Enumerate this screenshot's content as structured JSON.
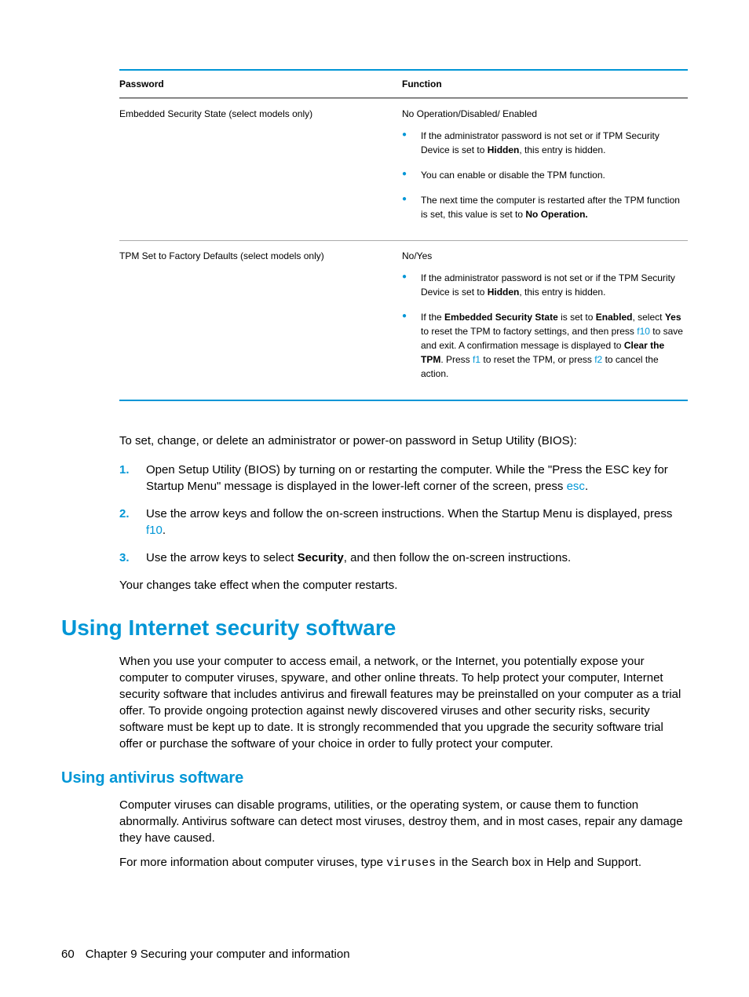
{
  "table": {
    "headers": {
      "left": "Password",
      "right": "Function"
    },
    "row1": {
      "name": "Embedded Security State (select models only)",
      "lead": "No Operation/Disabled/ Enabled",
      "b1a": "If the administrator password is not set or if TPM Security Device is set to ",
      "b1b": "Hidden",
      "b1c": ", this entry is hidden.",
      "b2": "You can enable or disable the TPM function.",
      "b3a": "The next time the computer is restarted after the TPM function is set, this value is set to ",
      "b3b": "No Operation."
    },
    "row2": {
      "name": "TPM Set to Factory Defaults (select models only)",
      "lead": "No/Yes",
      "b1a": "If the administrator password is not set or if the TPM Security Device is set to ",
      "b1b": "Hidden",
      "b1c": ", this entry is hidden.",
      "b2a": "If the ",
      "b2b": "Embedded Security State",
      "b2c": " is set to ",
      "b2d": "Enabled",
      "b2e": ", select ",
      "b2f": "Yes",
      "b2g": " to reset the TPM to factory settings, and then press ",
      "b2h": "f10",
      "b2i": " to save and exit. A confirmation message is displayed to ",
      "b2j": "Clear the TPM",
      "b2k": ". Press ",
      "b2l": "f1",
      "b2m": " to reset the TPM, or press ",
      "b2n": "f2",
      "b2o": " to cancel the action."
    }
  },
  "body": {
    "intro": "To set, change, or delete an administrator or power-on password in Setup Utility (BIOS):",
    "step1a": "Open Setup Utility (BIOS) by turning on or restarting the computer. While the \"Press the ESC key for Startup Menu\" message is displayed in the lower-left corner of the screen, press ",
    "step1b": "esc",
    "step1c": ".",
    "step2a": "Use the arrow keys and follow the on-screen instructions. When the Startup Menu is displayed, press ",
    "step2b": "f10",
    "step2c": ".",
    "step3a": "Use the arrow keys to select ",
    "step3b": "Security",
    "step3c": ", and then follow the on-screen instructions.",
    "outro": "Your changes take effect when the computer restarts.",
    "h1": "Using Internet security software",
    "p1": "When you use your computer to access email, a network, or the Internet, you potentially expose your computer to computer viruses, spyware, and other online threats. To help protect your computer, Internet security software that includes antivirus and firewall features may be preinstalled on your computer as a trial offer. To provide ongoing protection against newly discovered viruses and other security risks, security software must be kept up to date. It is strongly recommended that you upgrade the security software trial offer or purchase the software of your choice in order to fully protect your computer.",
    "h2": "Using antivirus software",
    "p2": "Computer viruses can disable programs, utilities, or the operating system, or cause them to function abnormally. Antivirus software can detect most viruses, destroy them, and in most cases, repair any damage they have caused.",
    "p3a": "For more information about computer viruses, type ",
    "p3b": "viruses",
    "p3c": " in the Search box in Help and Support."
  },
  "footer": {
    "page": "60",
    "chapter": "Chapter 9   Securing your computer and information"
  },
  "nums": {
    "n1": "1.",
    "n2": "2.",
    "n3": "3."
  }
}
